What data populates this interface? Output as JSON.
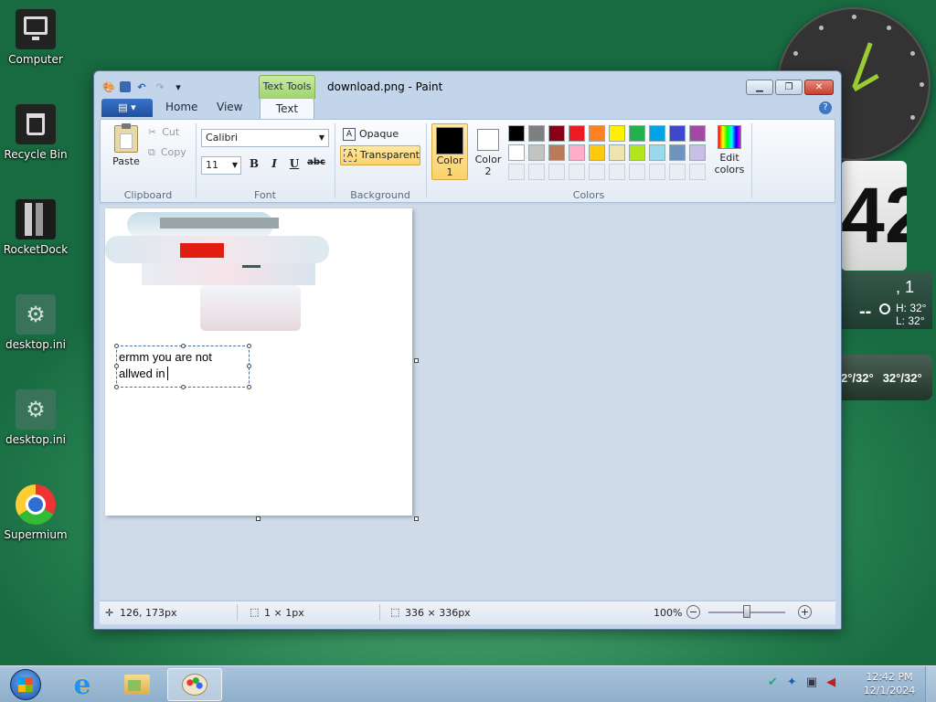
{
  "desktop": {
    "icons": [
      {
        "label": "Computer",
        "icon": "computer-icon"
      },
      {
        "label": "Recycle Bin",
        "icon": "recycle-bin-icon"
      },
      {
        "label": "RocketDock",
        "icon": "rocketdock-icon"
      },
      {
        "label": "desktop.ini",
        "icon": "settings-file-icon"
      },
      {
        "label": "desktop.ini",
        "icon": "settings-file-icon"
      },
      {
        "label": "Supermium",
        "icon": "supermium-browser-icon"
      }
    ]
  },
  "gadgets": {
    "flip_clock_digits": "42",
    "weather": {
      "top_text": ", 1",
      "current": "--",
      "high": "H: 32°",
      "low": "L: 32°"
    },
    "forecast": [
      "2°/32°",
      "32°/32°"
    ]
  },
  "window": {
    "title": "download.png - Paint",
    "context_tab": "Text Tools",
    "menu_label": "▤ ▾",
    "tabs": [
      "Home",
      "View",
      "Text"
    ],
    "active_tab": "Text",
    "ribbon": {
      "clipboard": {
        "paste": "Paste",
        "cut": "Cut",
        "copy": "Copy",
        "group": "Clipboard"
      },
      "font": {
        "family": "Calibri",
        "size": "11",
        "bold": "B",
        "italic": "I",
        "underline": "U",
        "strike": "abc",
        "group": "Font"
      },
      "background": {
        "opaque": "Opaque",
        "transparent": "Transparent",
        "group": "Background"
      },
      "colors": {
        "color1": "Color 1",
        "color2": "Color 2",
        "edit": "Edit colors",
        "group": "Colors",
        "color1_value": "#000000",
        "color2_value": "#ffffff",
        "palette_row1": [
          "#000000",
          "#7f7f7f",
          "#880015",
          "#ed1c24",
          "#ff7f27",
          "#fff200",
          "#22b14c",
          "#00a2e8",
          "#3f48cc",
          "#a349a4"
        ],
        "palette_row2": [
          "#ffffff",
          "#c3c3c3",
          "#b97a57",
          "#ffaec9",
          "#ffc90e",
          "#efe4b0",
          "#b5e61d",
          "#99d9ea",
          "#7092be",
          "#c8bfe7"
        ]
      }
    },
    "canvas": {
      "text_line1": "ermm you are not",
      "text_line2": "allwed in"
    },
    "status": {
      "cursor": "126, 173px",
      "selection": "1 × 1px",
      "size": "336 × 336px",
      "zoom": "100%"
    }
  },
  "taskbar": {
    "time": "12:42 PM",
    "date": "12/1/2024",
    "items": [
      "start-orb-icon",
      "internet-explorer-icon",
      "file-explorer-icon",
      "paint-icon"
    ]
  }
}
